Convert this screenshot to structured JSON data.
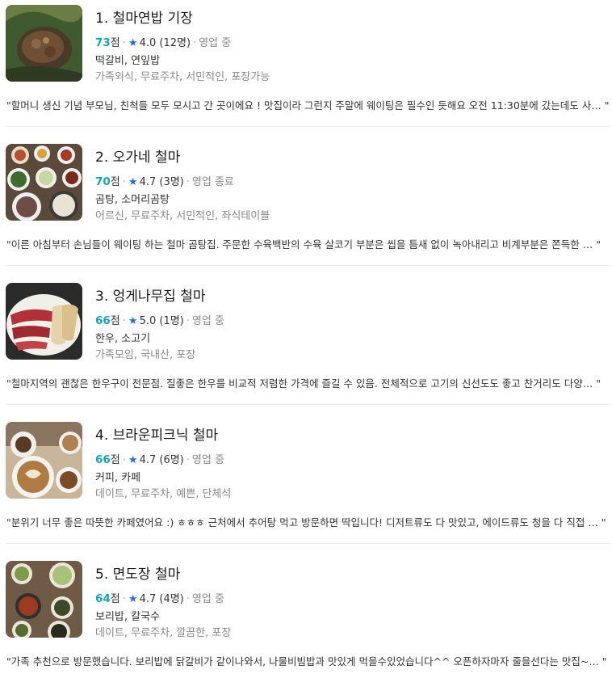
{
  "score_unit": "점",
  "items": [
    {
      "title": "1. 철마연밥 기장",
      "score": "73",
      "rating": "4.0 (12명)",
      "status": "영업 중",
      "category": "떡갈비, 연잎밥",
      "tags": "가족외식, 무료주차, 서민적인, 포장가능",
      "review": "\"할머니 생신 기념 부모님, 친척들 모두 모시고 간 곳이에요 ! 맛집이라 그런지 주말에 웨이팅은 필수인 듯해요 오전 11:30분에 갔는데도 사… \""
    },
    {
      "title": "2. 오가네 철마",
      "score": "70",
      "rating": "4.7 (3명)",
      "status": "영업 종료",
      "category": "곰탕, 소머리곰탕",
      "tags": "어르신, 무료주차, 서민적인, 좌식테이블",
      "review": "\"이른 아침부터 손님들이 웨이팅 하는 철마 곰탕집. 주문한 수육백반의 수육 살코기 부분은 씹을 틈새 없이 녹아내리고 비계부분은 쫀득한 … \""
    },
    {
      "title": "3. 엉게나무집 철마",
      "score": "66",
      "rating": "5.0 (1명)",
      "status": "영업 중",
      "category": "한우, 소고기",
      "tags": "가족모임, 국내산, 포장",
      "review": "\"철마지역의 괜찮은 한우구이 전문점. 질좋은 한우를 비교적 저렴한 가격에 즐길 수 있음. 전체적으로 고기의 신선도도 좋고 찬거리도 다양… \""
    },
    {
      "title": "4. 브라운피크닉 철마",
      "score": "66",
      "rating": "4.7 (6명)",
      "status": "영업 중",
      "category": "커피, 카페",
      "tags": "데이트, 무료주차, 예쁜, 단체석",
      "review": "\"분위기 너무 좋은 따뜻한 카페였어요 :) ㅎㅎㅎ 근처에서 추어탕 먹고 방문하면 딱입니다! 디저트류도 다 맛있고, 에이드류도 청을 다 직접 … \""
    },
    {
      "title": "5. 면도장 철마",
      "score": "64",
      "rating": "4.7 (4명)",
      "status": "영업 중",
      "category": "보리밥, 칼국수",
      "tags": "데이트, 무료주차, 깔끔한, 포장",
      "review": "\"가족 추천으로 방문했습니다. 보리밥에 닭갈비가 같이나와서, 나물비빔밥과 맛있게 먹을수있었습니다^^ 오픈하자마자 줄을선다는 맛집~… \""
    }
  ]
}
